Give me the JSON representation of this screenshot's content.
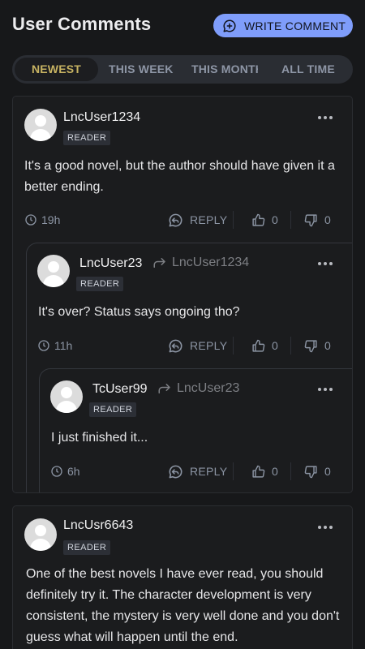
{
  "header": {
    "title": "User Comments",
    "write_button": "WRITE COMMENT"
  },
  "tabs": [
    "NEWEST",
    "THIS WEEK",
    "THIS MONTH",
    "ALL TIME"
  ],
  "actions": {
    "reply": "REPLY"
  },
  "icons": {
    "write": "comment-plus-icon",
    "time": "clock-icon",
    "reply": "reply-icon",
    "like": "thumbs-up-icon",
    "dislike": "thumbs-down-icon",
    "more": "more-dots-icon",
    "reply_to": "forward-arrow-icon"
  },
  "colors": {
    "accent": "#7f9dfb",
    "active_tab": "#c7b362",
    "background": "#17181a",
    "card": "#1b1c1e"
  },
  "comments": [
    {
      "user": "LncUser1234",
      "badge": "READER",
      "text": "It's a good novel, but the author should have given it a better ending.",
      "time": "19h",
      "likes": "0",
      "dislikes": "0",
      "replies": [
        {
          "user": "LncUser23",
          "reply_to": "LncUser1234",
          "badge": "READER",
          "text": "It's over? Status says ongoing tho?",
          "time": "11h",
          "likes": "0",
          "dislikes": "0",
          "replies": [
            {
              "user": "TcUser99",
              "reply_to": "LncUser23",
              "badge": "READER",
              "text": "I just finished it...",
              "time": "6h",
              "likes": "0",
              "dislikes": "0"
            }
          ]
        }
      ]
    },
    {
      "user": "LncUsr6643",
      "badge": "READER",
      "text": "One of the best novels I have ever read, you should definitely try it. The character development is very consistent, the mystery is very well done and you don't guess what will happen until the end."
    }
  ]
}
